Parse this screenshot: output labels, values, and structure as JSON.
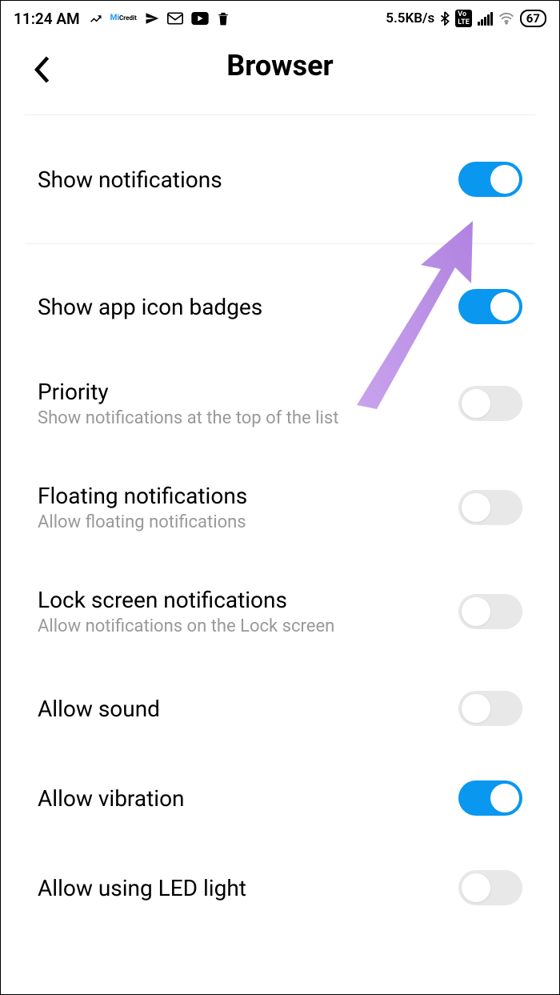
{
  "status_bar": {
    "time": "11:24 AM",
    "network_speed": "5.5KB/s",
    "battery": "67"
  },
  "header": {
    "title": "Browser"
  },
  "settings": {
    "show_notifications": {
      "label": "Show notifications",
      "on": true
    },
    "show_badges": {
      "label": "Show app icon badges",
      "on": true
    },
    "priority": {
      "label": "Priority",
      "sublabel": "Show notifications at the top of the list",
      "on": false
    },
    "floating": {
      "label": "Floating notifications",
      "sublabel": "Allow floating notifications",
      "on": false
    },
    "lock_screen": {
      "label": "Lock screen notifications",
      "sublabel": "Allow notifications on the Lock screen",
      "on": false
    },
    "allow_sound": {
      "label": "Allow sound",
      "on": false
    },
    "allow_vibration": {
      "label": "Allow vibration",
      "on": true
    },
    "allow_led": {
      "label": "Allow using LED light",
      "on": false
    }
  },
  "colors": {
    "toggle_on": "#0997f0",
    "toggle_off": "#e8e8e8",
    "arrow": "#b98ae6"
  }
}
